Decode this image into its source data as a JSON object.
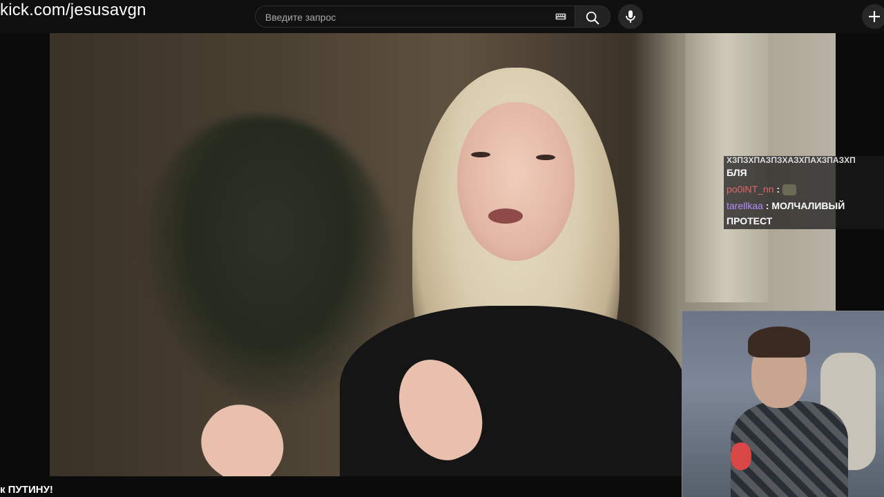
{
  "watermark": "kick.com/jesusavgn",
  "search": {
    "placeholder": "Введите запрос",
    "value": ""
  },
  "icons": {
    "keyboard": "keyboard-icon",
    "search": "search-icon",
    "mic": "microphone-icon",
    "create": "plus-icon"
  },
  "chat": {
    "messages": [
      {
        "user": "",
        "user_color": "#ffffff",
        "text": "ХЗПЗХПАЗПЗХАЗХПАХЗПАЗХП"
      },
      {
        "user": "",
        "user_color": "#ffffff",
        "text": "БЛЯ"
      },
      {
        "user": "po0iNT_nn",
        "user_color": "#e06a6a",
        "text": "",
        "emote": "emote-icon"
      },
      {
        "user": "tarellkaa",
        "user_color": "#b58bff",
        "text": "МОЛЧАЛИВЫЙ ПРОТЕСТ"
      }
    ]
  },
  "caption": "к ПУТИНУ!",
  "colors": {
    "background": "#0f0f0f",
    "accent": "#ffffff"
  }
}
